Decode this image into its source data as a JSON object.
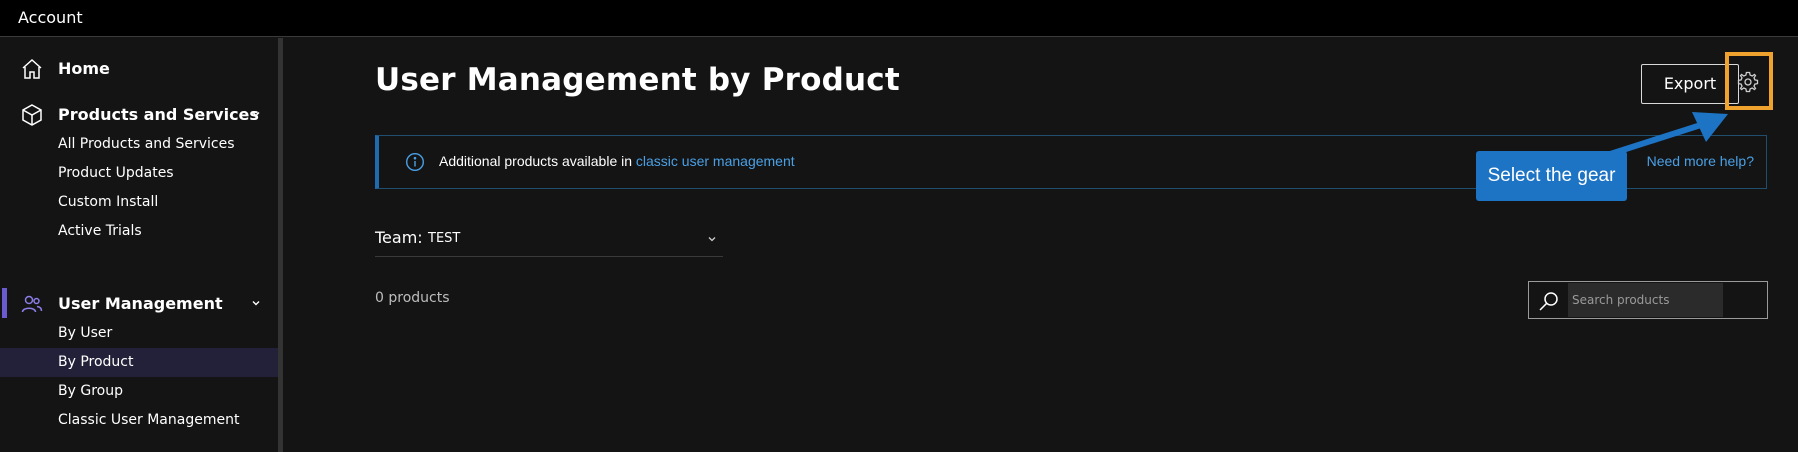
{
  "app": {
    "title": "Account"
  },
  "sidebar": {
    "home": {
      "label": "Home",
      "icon": "home-icon"
    },
    "products": {
      "label": "Products and Services",
      "icon": "cube-icon",
      "items": [
        {
          "label": "All Products and Services"
        },
        {
          "label": "Product Updates"
        },
        {
          "label": "Custom Install"
        },
        {
          "label": "Active Trials"
        }
      ]
    },
    "users": {
      "label": "User Management",
      "icon": "users-icon",
      "items": [
        {
          "label": "By User"
        },
        {
          "label": "By Product",
          "selected": true
        },
        {
          "label": "By Group"
        },
        {
          "label": "Classic User Management"
        }
      ]
    }
  },
  "main": {
    "title": "User Management by Product",
    "export_label": "Export",
    "banner": {
      "text": "Additional products available in ",
      "link": "classic user management",
      "help": "Need more help?"
    },
    "callout": "Select the gear",
    "team": {
      "label": "Team:",
      "value": "TEST"
    },
    "count": "0 products",
    "search": {
      "placeholder": "Search products"
    }
  },
  "colors": {
    "accent": "#6b5bd0",
    "link": "#4aa0e6",
    "highlight": "#f0a22e",
    "callout": "#1d73c4"
  }
}
